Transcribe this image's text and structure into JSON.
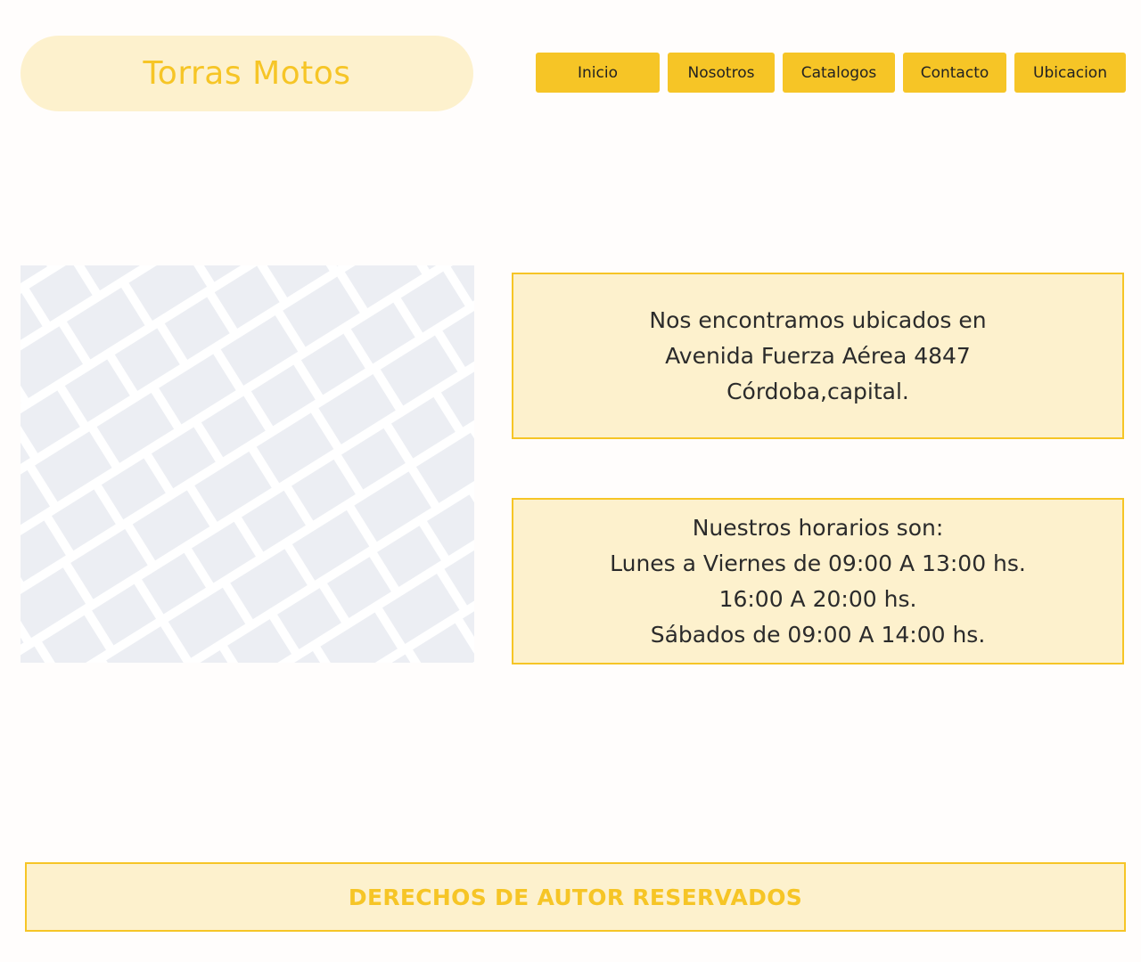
{
  "header": {
    "brand": "Torras Motos"
  },
  "nav": {
    "items": [
      "Inicio",
      "Nosotros",
      "Catalogos",
      "Contacto",
      "Ubicacion"
    ]
  },
  "location": {
    "address_lines": [
      "Nos encontramos ubicados en",
      "Avenida Fuerza Aérea 4847",
      "Córdoba,capital."
    ],
    "hours_lines": [
      "Nuestros horarios son:",
      "Lunes a Viernes de 09:00 A 13:00 hs.",
      "16:00 A 20:00 hs.",
      "Sábados de 09:00 A 14:00 hs."
    ]
  },
  "footer": {
    "text": "DERECHOS DE AUTOR RESERVADOS"
  },
  "colors": {
    "accent": "#f6c526",
    "accent_light": "#fdf1cd",
    "map_block": "#eceef3"
  },
  "icons": {
    "map": "street-map-icon"
  }
}
